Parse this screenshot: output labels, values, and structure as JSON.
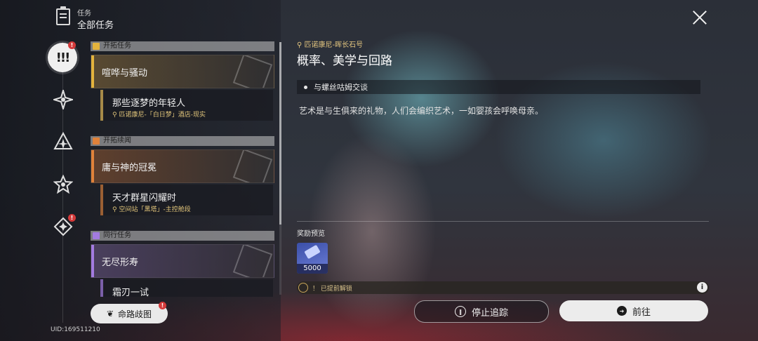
{
  "header": {
    "small": "任务",
    "title": "全部任务"
  },
  "rail": {
    "active_badge": "!",
    "badge_5": "!"
  },
  "sections": [
    {
      "label": "开拓任务",
      "color": "#e3b33d"
    },
    {
      "label": "开拓续闻",
      "color": "#e0823a"
    },
    {
      "label": "同行任务",
      "color": "#a37be0"
    }
  ],
  "quests": {
    "q1": {
      "title": "喧哗与骚动",
      "accent": "#e3b33d"
    },
    "q1_sub": {
      "title": "那些逐梦的年轻人",
      "location": "匹诺康尼-「白日梦」酒店-现实"
    },
    "q2": {
      "title": "庸与神的冠冕",
      "accent": "#e0823a"
    },
    "q2_sub": {
      "title": "天才群星闪耀时",
      "location": "空间站「黑塔」-主控舱段"
    },
    "q3": {
      "title": "无尽形寿",
      "accent": "#a37be0"
    },
    "q3_sub": {
      "title": "霜刃一试"
    }
  },
  "atlas_button": {
    "label": "命路歧图",
    "badge": "!"
  },
  "uid": "UID:169511210",
  "detail": {
    "location": "匹诺康尼-晖长石号",
    "title": "概率、美学与回路",
    "objective": "与螺丝咕姆交谈",
    "description": "艺术是与生俱来的礼物，人们会编织艺术，一如婴孩会呼唤母亲。",
    "reward_label": "奖励预览",
    "reward_qty": "5000",
    "unlock_text": "！ 已提前解锁",
    "info_icon": "i"
  },
  "buttons": {
    "stop": "停止追踪",
    "go": "前往"
  }
}
